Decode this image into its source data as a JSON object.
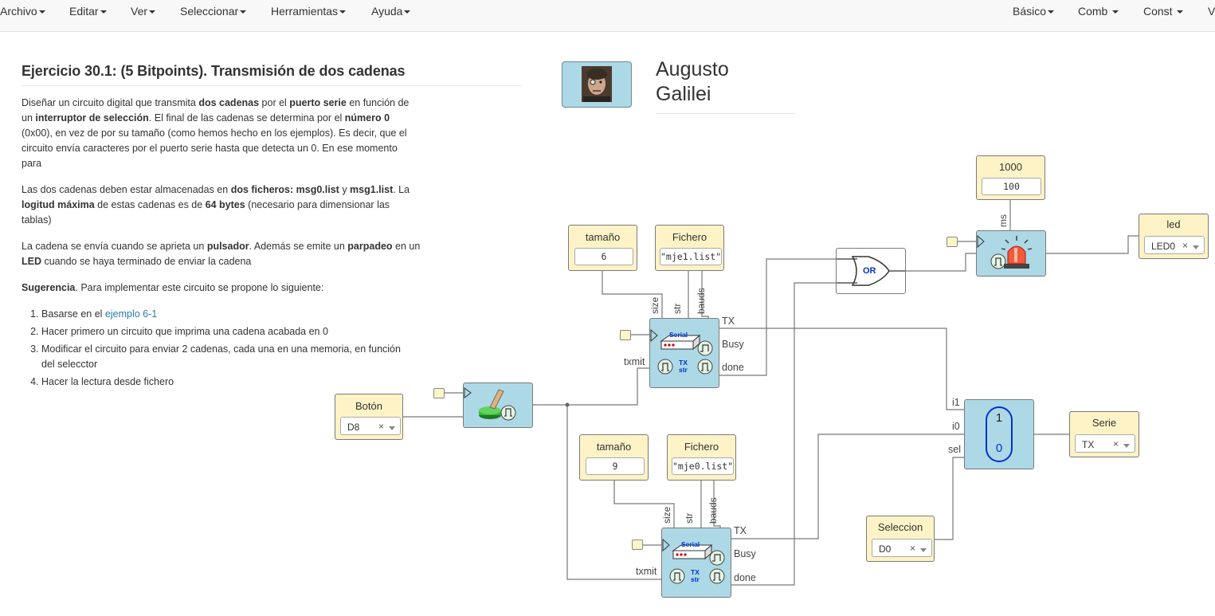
{
  "menu": {
    "left": [
      "Archivo",
      "Editar",
      "Ver",
      "Seleccionar",
      "Herramientas",
      "Ayuda"
    ],
    "right": [
      "Básico",
      "Comb",
      "Const",
      "V"
    ]
  },
  "exercise": {
    "title": "Ejercicio 30.1: (5 Bitpoints). Transmisión de dos cadenas",
    "p1": [
      "Diseñar un circuito digital que transmita ",
      "dos cadenas",
      " por el ",
      "puerto serie",
      " en función de un ",
      "interruptor de selección",
      ". El final de las cadenas se determina por el ",
      "número 0",
      " (0x00), en vez de por su tamaño (como hemos hecho en los ejemplos). Es decir, que el circuito envía caracteres por el puerto serie hasta que detecta un 0. En ese momento para"
    ],
    "p2": [
      "Las dos cadenas deben estar almacenadas en ",
      "dos ficheros: msg0.list",
      " y ",
      "msg1.list",
      ". La ",
      "logitud máxima",
      " de estas cadenas es de ",
      "64 bytes",
      " (necesario para dimensionar las tablas)"
    ],
    "p3": [
      "La cadena se envía cuando se aprieta un ",
      "pulsador",
      ". Además se emite un ",
      "parpadeo",
      " en un ",
      "LED",
      " cuando se haya terminado de enviar la cadena"
    ],
    "p4": [
      "Sugerencia",
      ". Para implementar este circuito se propone lo siguiente:"
    ],
    "steps": [
      {
        "text": "Basarse en el ",
        "link": "ejemplo 6-1"
      },
      {
        "text": "Hacer primero un circuito que imprima una cadena acabada en 0",
        "link": ""
      },
      {
        "text": "Modificar el circuito para enviar 2 cadenas, cada una en una memoria, en función del selecctor",
        "link": ""
      },
      {
        "text": "Hacer la lectura desde fichero",
        "link": ""
      }
    ]
  },
  "user": {
    "first": "Augusto",
    "last": "Galilei"
  },
  "circuit": {
    "size1": {
      "label": "tamaño",
      "value": "6"
    },
    "file1": {
      "label": "Fichero",
      "value": "\"mje1.list\""
    },
    "size0": {
      "label": "tamaño",
      "value": "9"
    },
    "file0": {
      "label": "Fichero",
      "value": "\"mje0.list\""
    },
    "timer": {
      "label": "1000",
      "value": "100",
      "port": "ms"
    },
    "led": {
      "label": "led",
      "value": "LED0"
    },
    "boton": {
      "label": "Botón",
      "value": "D8"
    },
    "serie": {
      "label": "Serie",
      "value": "TX"
    },
    "seleccion": {
      "label": "Seleccion",
      "value": "D0"
    },
    "or_label": "OR",
    "serial_label": "Serial",
    "tx_label": "TX",
    "str_label": "str",
    "ports": {
      "size": "size",
      "str": "str",
      "bauds": "bauds",
      "TX": "TX",
      "Busy": "Busy",
      "done": "done",
      "txmit": "txmit",
      "i1": "i1",
      "i0": "i0",
      "sel": "sel"
    },
    "mux": {
      "top": "1",
      "bottom": "0"
    }
  },
  "colors": {
    "block_blue": "#add8e6",
    "block_yellow": "#fdf3c6",
    "wire": "#777777",
    "link": "#2a7ab0"
  }
}
